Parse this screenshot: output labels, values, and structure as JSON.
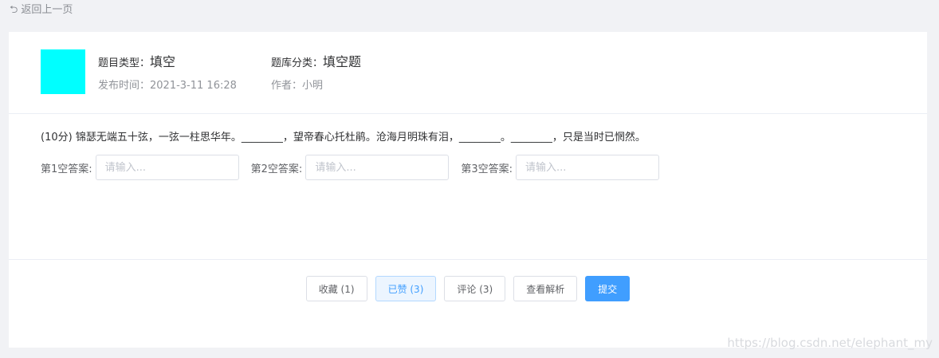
{
  "nav": {
    "back_icon": "return-arrow-icon",
    "back_label": "返回上一页"
  },
  "header": {
    "thumb_color": "#00ffff",
    "type_label": "题目类型：",
    "type_value": "填空",
    "category_label": "题库分类：",
    "category_value": "填空题",
    "published_label": "发布时间：",
    "published_value": "2021-3-11 16:28",
    "author_label": "作者：",
    "author_value": "小明"
  },
  "question": {
    "text": "(10分) 锦瑟无端五十弦，一弦一柱思华年。________，望帝春心托杜鹃。沧海月明珠有泪，________。________，只是当时已惘然。",
    "answers": [
      {
        "label": "第1空答案:",
        "placeholder": "请输入...",
        "value": ""
      },
      {
        "label": "第2空答案:",
        "placeholder": "请输入...",
        "value": ""
      },
      {
        "label": "第3空答案:",
        "placeholder": "请输入...",
        "value": ""
      }
    ]
  },
  "actions": {
    "favorite_label": "收藏 (1)",
    "liked_label": "已赞 (3)",
    "comment_label": "评论 (3)",
    "analysis_label": "查看解析",
    "submit_label": "提交"
  },
  "watermark": "https://blog.csdn.net/elephant_my",
  "colors": {
    "primary": "#409eff",
    "background": "#f1f2f5",
    "card": "#ffffff"
  }
}
